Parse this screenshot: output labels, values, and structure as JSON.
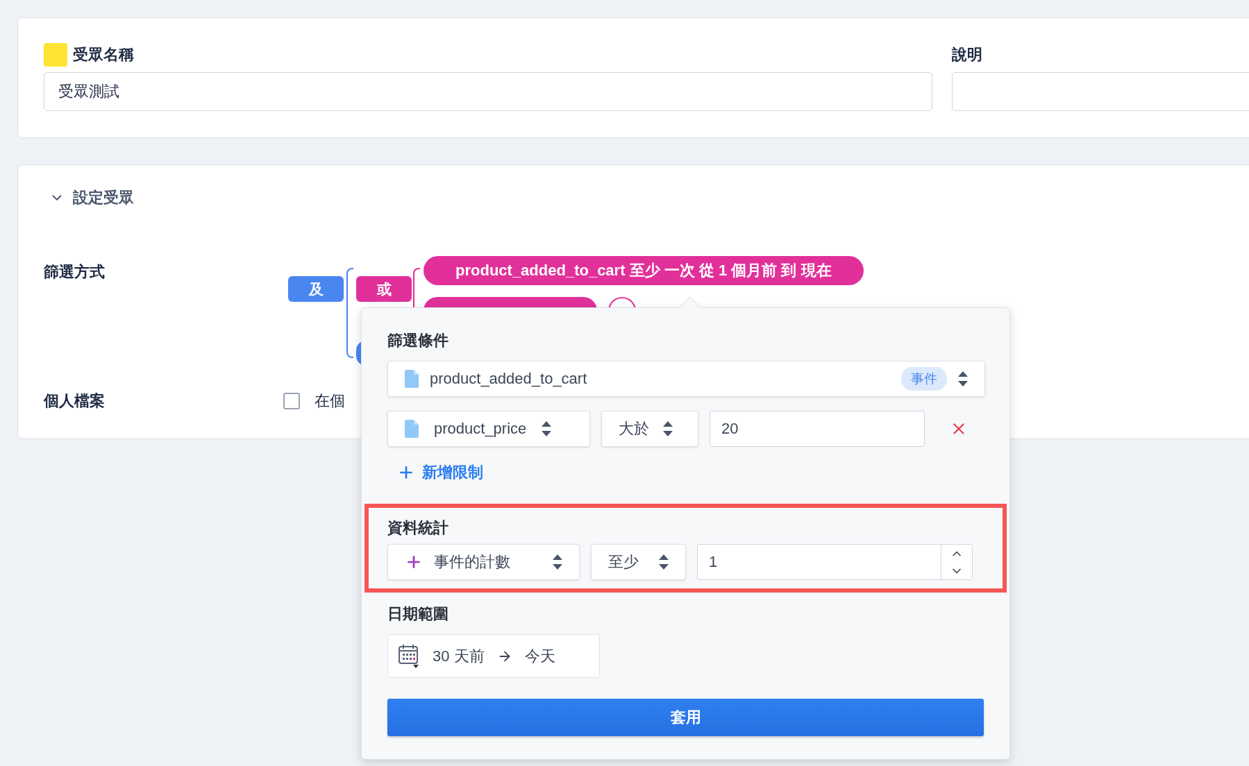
{
  "audience_name": {
    "label": "受眾名稱",
    "color": "#ffe433",
    "value": "受眾測試"
  },
  "description": {
    "label": "說明"
  },
  "section": {
    "title": "設定受眾",
    "expanded": true
  },
  "filter_method": {
    "label": "篩選方式",
    "root_operator": "及",
    "group_operator": "或",
    "condition": "product_added_to_cart 至少 一次 從 1 個月前 到 現在"
  },
  "profile": {
    "label": "個人檔案",
    "checked": false,
    "option": "在個"
  },
  "popover": {
    "filter_title": "篩選條件",
    "event": {
      "name": "product_added_to_cart",
      "badge": "事件"
    },
    "constraint": {
      "property": "product_price",
      "operator": "大於",
      "value": "20"
    },
    "add_constraint": "新增限制",
    "stats_title": "資料統計",
    "stats": {
      "metric": "事件的計數",
      "operator": "至少",
      "value": "1",
      "highlighted": true
    },
    "date_title": "日期範圍",
    "date_range": {
      "from": "30 天前",
      "to": "今天"
    },
    "apply": "套用"
  }
}
